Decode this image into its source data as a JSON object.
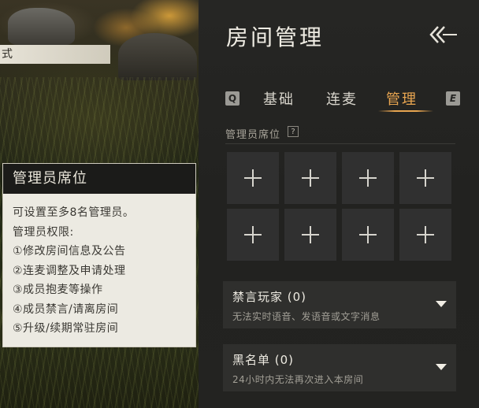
{
  "scene": {
    "top_label": "式"
  },
  "tooltip": {
    "title": "管理员席位",
    "lines": [
      "可设置至多8名管理员。",
      "管理员权限:",
      "①修改房间信息及公告",
      "②连麦调整及申请处理",
      "③成员抱麦等操作",
      "④成员禁言/请离房间",
      "⑤升级/续期常驻房间"
    ]
  },
  "panel": {
    "title": "房间管理",
    "tabs": {
      "key_left": "Q",
      "key_right": "E",
      "items": [
        "基础",
        "连麦",
        "管理"
      ],
      "active_index": 2
    },
    "section_label": "管理员席位",
    "help_icon_text": "?",
    "admin_slots": 8,
    "dropdowns": [
      {
        "title": "禁言玩家 (0)",
        "subtitle": "无法实时语音、发语音或文字消息"
      },
      {
        "title": "黑名单 (0)",
        "subtitle": "24小时内无法再次进入本房间"
      }
    ]
  },
  "colors": {
    "accent": "#e8a550",
    "panel_bg": "#242422",
    "slot_bg": "#303030"
  },
  "icons": {
    "back": "double-chevron-left-arrow-icon",
    "slot": "plus-icon",
    "dropdown": "caret-down-icon"
  }
}
